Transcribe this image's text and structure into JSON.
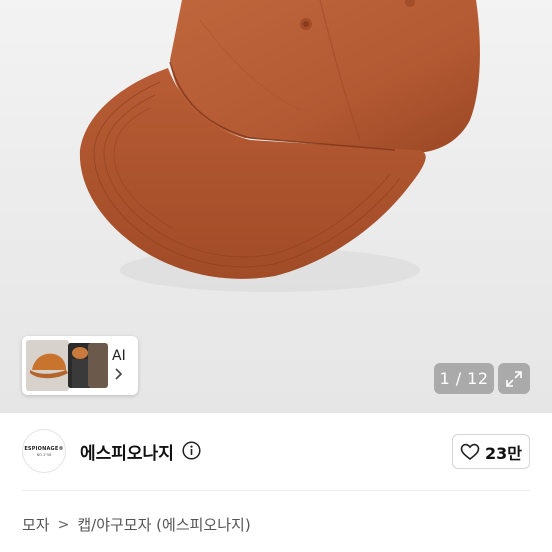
{
  "gallery": {
    "ai_label": "AI",
    "counter": "1 / 12"
  },
  "brand": {
    "logo_line1": "ESPIONAGE®",
    "logo_line2": "NO.1°58",
    "name": "에스피오나지"
  },
  "like": {
    "count": "23만"
  },
  "breadcrumb": {
    "level1": "모자",
    "separator": ">",
    "level2": "캡/야구모자 (에스피오나지)"
  },
  "colors": {
    "cap": "#b45a33",
    "cap_shadow": "#8f3f1f",
    "background": "#ececec",
    "overlay": "#969696"
  }
}
